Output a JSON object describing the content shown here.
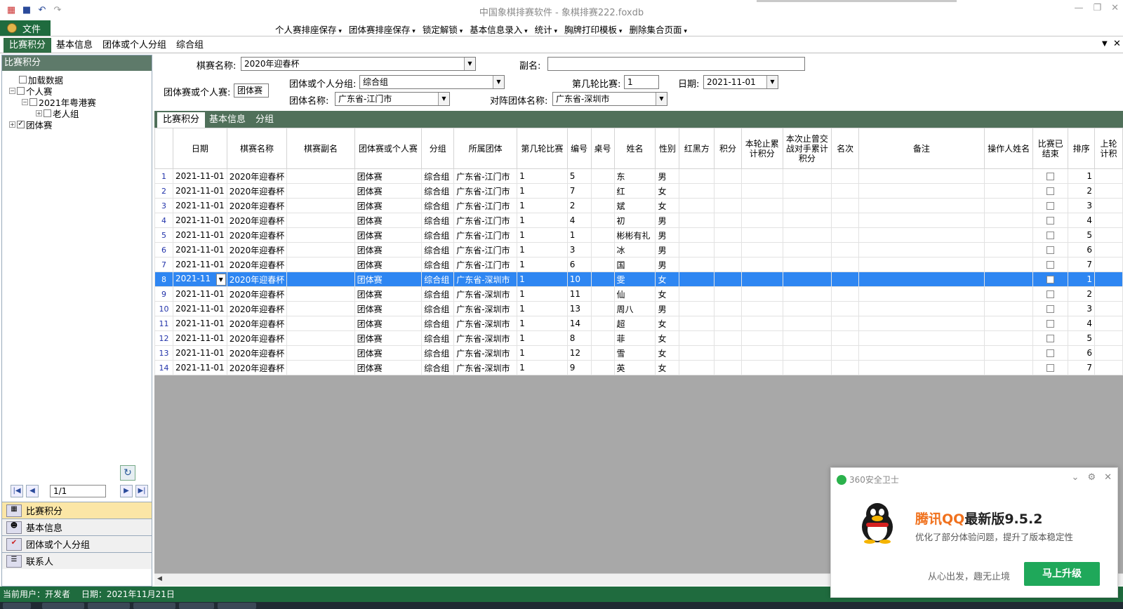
{
  "window": {
    "title": "中国象棋排赛软件 - 象棋排赛222.foxdb"
  },
  "ribbon": {
    "file_label": "文件",
    "menus": [
      "个人赛排座保存",
      "团体赛排座保存",
      "锁定解锁",
      "基本信息录入",
      "统计",
      "胸牌打印模板",
      "删除集合页面"
    ]
  },
  "tabs": [
    "比赛积分",
    "基本信息",
    "团体或个人分组",
    "综合组"
  ],
  "left_panel": {
    "title": "比赛积分",
    "tree": [
      {
        "label": "加载数据",
        "checked": false
      },
      {
        "label": "个人赛",
        "checked": false
      },
      {
        "label": "2021年粤港赛",
        "checked": false
      },
      {
        "label": "老人组",
        "checked": false
      },
      {
        "label": "团体赛",
        "checked": true
      }
    ],
    "pager": {
      "page": "1/1"
    },
    "nav": [
      "比赛积分",
      "基本信息",
      "团体或个人分组",
      "联系人"
    ]
  },
  "form": {
    "match_name_label": "棋赛名称:",
    "match_name_value": "2020年迎春杯",
    "subname_label": "副名:",
    "subname_value": "",
    "type_label": "团体赛或个人赛:",
    "type_value": "团体赛",
    "group_label": "团体或个人分组:",
    "group_value": "综合组",
    "round_label": "第几轮比赛:",
    "round_value": "1",
    "date_label": "日期:",
    "date_value": "2021-11-01",
    "team_label": "团体名称:",
    "team_value": "广东省-江门市",
    "opp_label": "对阵团体名称:",
    "opp_value": "广东省-深圳市"
  },
  "subtabs": [
    "比赛积分",
    "基本信息",
    "分组"
  ],
  "grid": {
    "headers": [
      "日期",
      "棋赛名称",
      "棋赛副名",
      "团体赛或个人赛",
      "分组",
      "所属团体",
      "第几轮比赛",
      "编号",
      "桌号",
      "姓名",
      "性别",
      "红黑方",
      "积分",
      "本轮止累计积分",
      "本次止曾交战对手累计积分",
      "名次",
      "备注",
      "操作人姓名",
      "比赛已结束",
      "排序",
      "上轮计积"
    ],
    "rows": [
      {
        "n": "1",
        "date": "2021-11-01",
        "match": "2020年迎春杯",
        "type": "团体赛",
        "group": "综合组",
        "team": "广东省-江门市",
        "round": "1",
        "no": "5",
        "name": "东",
        "sex": "男",
        "order": "1"
      },
      {
        "n": "2",
        "date": "2021-11-01",
        "match": "2020年迎春杯",
        "type": "团体赛",
        "group": "综合组",
        "team": "广东省-江门市",
        "round": "1",
        "no": "7",
        "name": "红",
        "sex": "女",
        "order": "2"
      },
      {
        "n": "3",
        "date": "2021-11-01",
        "match": "2020年迎春杯",
        "type": "团体赛",
        "group": "综合组",
        "team": "广东省-江门市",
        "round": "1",
        "no": "2",
        "name": "斌",
        "sex": "女",
        "order": "3"
      },
      {
        "n": "4",
        "date": "2021-11-01",
        "match": "2020年迎春杯",
        "type": "团体赛",
        "group": "综合组",
        "team": "广东省-江门市",
        "round": "1",
        "no": "4",
        "name": "初",
        "sex": "男",
        "order": "4"
      },
      {
        "n": "5",
        "date": "2021-11-01",
        "match": "2020年迎春杯",
        "type": "团体赛",
        "group": "综合组",
        "team": "广东省-江门市",
        "round": "1",
        "no": "1",
        "name": "彬彬有礼",
        "sex": "男",
        "order": "5"
      },
      {
        "n": "6",
        "date": "2021-11-01",
        "match": "2020年迎春杯",
        "type": "团体赛",
        "group": "综合组",
        "team": "广东省-江门市",
        "round": "1",
        "no": "3",
        "name": "冰",
        "sex": "男",
        "order": "6"
      },
      {
        "n": "7",
        "date": "2021-11-01",
        "match": "2020年迎春杯",
        "type": "团体赛",
        "group": "综合组",
        "team": "广东省-江门市",
        "round": "1",
        "no": "6",
        "name": "国",
        "sex": "男",
        "order": "7"
      },
      {
        "n": "8",
        "date": "2021-11",
        "match": "2020年迎春杯",
        "type": "团体赛",
        "group": "综合组",
        "team": "广东省-深圳市",
        "round": "1",
        "no": "10",
        "name": "雯",
        "sex": "女",
        "order": "1",
        "selected": true
      },
      {
        "n": "9",
        "date": "2021-11-01",
        "match": "2020年迎春杯",
        "type": "团体赛",
        "group": "综合组",
        "team": "广东省-深圳市",
        "round": "1",
        "no": "11",
        "name": "仙",
        "sex": "女",
        "order": "2"
      },
      {
        "n": "10",
        "date": "2021-11-01",
        "match": "2020年迎春杯",
        "type": "团体赛",
        "group": "综合组",
        "team": "广东省-深圳市",
        "round": "1",
        "no": "13",
        "name": "周八",
        "sex": "男",
        "order": "3"
      },
      {
        "n": "11",
        "date": "2021-11-01",
        "match": "2020年迎春杯",
        "type": "团体赛",
        "group": "综合组",
        "team": "广东省-深圳市",
        "round": "1",
        "no": "14",
        "name": "超",
        "sex": "女",
        "order": "4"
      },
      {
        "n": "12",
        "date": "2021-11-01",
        "match": "2020年迎春杯",
        "type": "团体赛",
        "group": "综合组",
        "team": "广东省-深圳市",
        "round": "1",
        "no": "8",
        "name": "菲",
        "sex": "女",
        "order": "5"
      },
      {
        "n": "13",
        "date": "2021-11-01",
        "match": "2020年迎春杯",
        "type": "团体赛",
        "group": "综合组",
        "team": "广东省-深圳市",
        "round": "1",
        "no": "12",
        "name": "雪",
        "sex": "女",
        "order": "6"
      },
      {
        "n": "14",
        "date": "2021-11-01",
        "match": "2020年迎春杯",
        "type": "团体赛",
        "group": "综合组",
        "team": "广东省-深圳市",
        "round": "1",
        "no": "9",
        "name": "英",
        "sex": "女",
        "order": "7"
      }
    ]
  },
  "status": {
    "user": "当前用户：开发者",
    "date": "日期：2021年11月21日"
  },
  "popup": {
    "source": "360安全卫士",
    "brand": "腾讯QQ",
    "title_rest": "最新版9.5.2",
    "desc": "优化了部分体验问题，提升了版本稳定性",
    "slogan": "从心出发，趣无止境",
    "button": "马上升级"
  },
  "colors": {
    "accent_green": "#1f6b3e",
    "selection_blue": "#2e86f2",
    "qq_orange": "#f0711d",
    "upgrade_green": "#1fa85a"
  }
}
